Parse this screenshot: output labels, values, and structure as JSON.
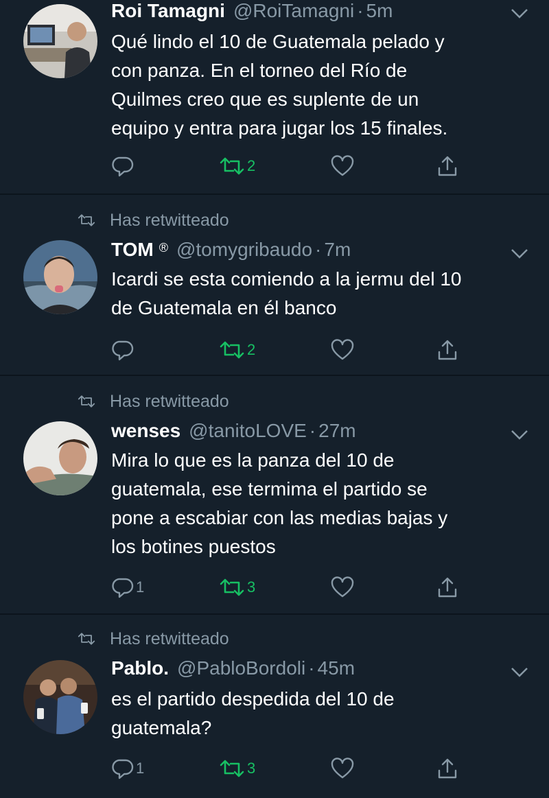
{
  "tweets": [
    {
      "retweet_label": "",
      "name": "Roi Tamagni",
      "badge": "",
      "handle": "@RoiTamagni",
      "dot": "·",
      "time": "5m",
      "text": "Qué lindo el 10 de Guatemala pelado y\ncon panza. En el torneo del Río de\nQuilmes creo que es suplente de un\nequipo y entra para jugar los 15 finales.",
      "reply_count": "",
      "retweet_count": "2",
      "like_count": ""
    },
    {
      "retweet_label": "Has retwitteado",
      "name": "TOM",
      "badge": "®",
      "handle": "@tomygribaudo",
      "dot": "·",
      "time": "7m",
      "text": "Icardi se esta comiendo a la jermu del 10\nde Guatemala en él banco",
      "reply_count": "",
      "retweet_count": "2",
      "like_count": ""
    },
    {
      "retweet_label": "Has retwitteado",
      "name": "wenses",
      "badge": "",
      "handle": "@tanitoLOVE",
      "dot": "·",
      "time": "27m",
      "text": "Mira lo que es la panza del 10 de\nguatemala, ese termima el partido se\npone a escabiar con las medias bajas y\nlos botines puestos",
      "reply_count": "1",
      "retweet_count": "3",
      "like_count": ""
    },
    {
      "retweet_label": "Has retwitteado",
      "name": "Pablo.",
      "badge": "",
      "handle": "@PabloBordoli",
      "dot": "·",
      "time": "45m",
      "text": "es el partido despedida del 10 de\nguatemala?",
      "reply_count": "1",
      "retweet_count": "3",
      "like_count": ""
    }
  ],
  "colors": {
    "background": "#15202b",
    "secondary_text": "#8899a6",
    "retweet_active": "#17bf63",
    "divider": "#0c141c"
  },
  "icons": [
    "reply-icon",
    "retweet-icon",
    "like-icon",
    "share-icon",
    "chevron-down-icon",
    "retweeted-icon"
  ]
}
